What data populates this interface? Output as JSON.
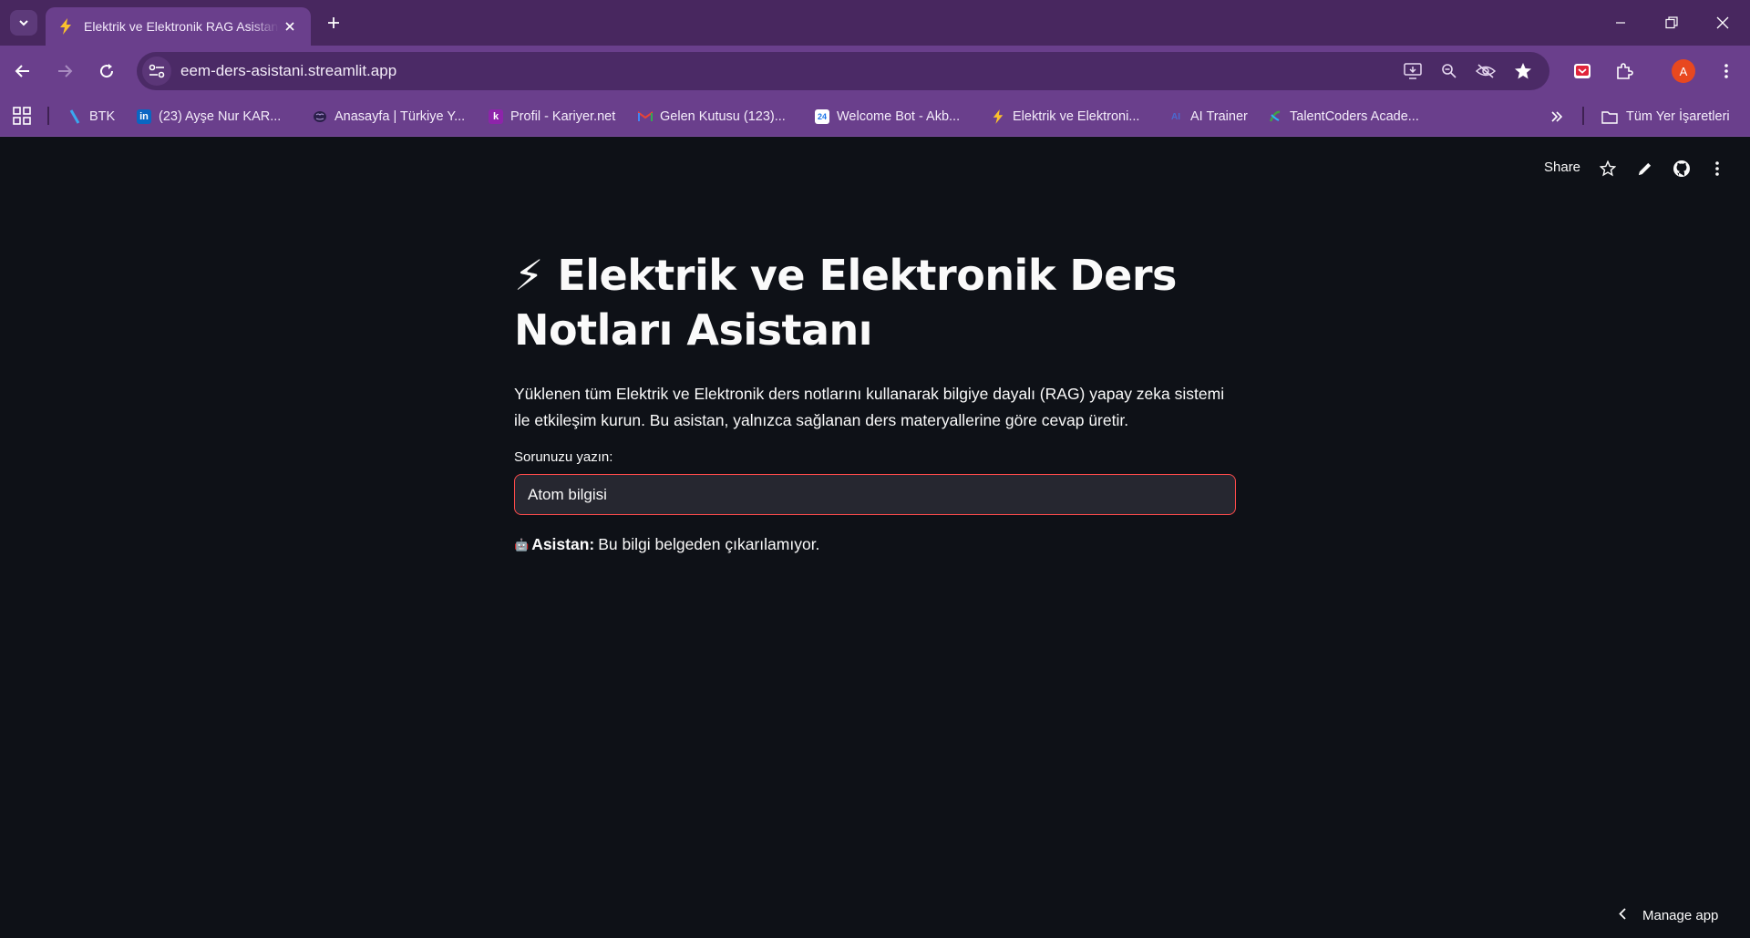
{
  "browser": {
    "tab": {
      "title": "Elektrik ve Elektronik RAG Asistanı",
      "favicon": "lightning-icon"
    },
    "url": "eem-ders-asistani.streamlit.app",
    "profile_initial": "A",
    "bookmarks": [
      {
        "label": "BTK",
        "icon": "btk-logo",
        "color": "#3aa8f0"
      },
      {
        "label": "(23) Ayşe Nur KAR...",
        "icon": "linkedin-icon",
        "color": "#0a66c2"
      },
      {
        "label": "Anasayfa | Türkiye Y...",
        "icon": "brain-icon",
        "color": "#7e57c2"
      },
      {
        "label": "Profil - Kariyer.net",
        "icon": "kariyer-icon",
        "color": "#8e24aa"
      },
      {
        "label": "Gelen Kutusu (123)...",
        "icon": "gmail-icon",
        "color": "#ea4335"
      },
      {
        "label": "Welcome Bot - Akb...",
        "icon": "calendar-icon",
        "color": "#4285f4"
      },
      {
        "label": "Elektrik ve Elektroni...",
        "icon": "lightning-icon",
        "color": "#fbc02d"
      },
      {
        "label": "AI Trainer",
        "icon": "ai-icon",
        "color": "#2e4a9e"
      },
      {
        "label": "TalentCoders Acade...",
        "icon": "talentcoders-icon",
        "color": "#43a047"
      }
    ],
    "all_bookmarks_label": "Tüm Yer İşaretleri"
  },
  "streamlit_header": {
    "share_label": "Share"
  },
  "main": {
    "title_emoji": "⚡",
    "title_text": "Elektrik ve Elektronik Ders Notları Asistanı",
    "description": "Yüklenen tüm Elektrik ve Elektronik ders notlarını kullanarak bilgiye dayalı (RAG) yapay zeka sistemi ile etkileşim kurun. Bu asistan, yalnızca sağlanan ders materyallerine göre cevap üretir.",
    "input_label": "Sorunuzu yazın:",
    "input_value": "Atom bilgisi",
    "answer_icon": "🤖",
    "answer_prefix": "Asistan:",
    "answer_text": "Bu bilgi belgeden çıkarılamıyor."
  },
  "manage_app_label": "Manage app",
  "colors": {
    "accent": "#ff4b4b",
    "background": "#0e1117",
    "input_bg": "#262730",
    "browser_frame": "#6a3f8c"
  }
}
